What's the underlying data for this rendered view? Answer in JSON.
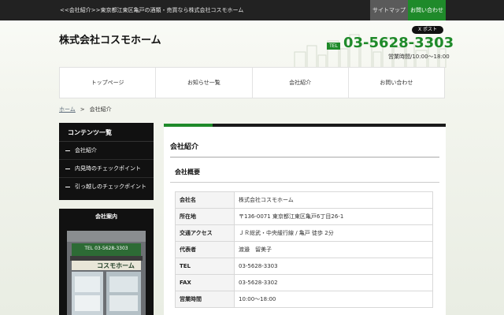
{
  "topbar": {
    "tagline": "<<会社紹介>>東京都江東区亀戸の酒類・売買なら株式会社コスモホーム",
    "sitemap": "サイトマップ",
    "contact": "お問い合わせ"
  },
  "header": {
    "logo": "株式会社コスモホーム",
    "post_button": "X ポスト",
    "tel_badge": "TEL",
    "tel_number": "03-5628-3303",
    "hours": "営業時間/10:00～18:00"
  },
  "nav": {
    "items": [
      "トップページ",
      "お知らせ一覧",
      "会社紹介",
      "お問い合わせ"
    ]
  },
  "breadcrumb": {
    "home": "ホーム",
    "sep": ">",
    "current": "会社紹介"
  },
  "sidebar": {
    "title": "コンテンツ一覧",
    "items": [
      "会社紹介",
      "内見時のチェックポイント",
      "引っ越しのチェックポイント"
    ],
    "company_title": "会社案内",
    "photo_sign_text": "コスモホーム",
    "photo_tel_text": "TEL 03-5628-3303"
  },
  "main": {
    "title": "会社紹介",
    "subtitle": "会社概要",
    "rows": [
      {
        "k": "会社名",
        "v": "株式会社コスモホーム"
      },
      {
        "k": "所在地",
        "v": "〒136-0071 東京都江東区亀戸6丁目26-1"
      },
      {
        "k": "交通アクセス",
        "v": "ＪＲ総武・中央緩行線 / 亀戸 徒歩 2分"
      },
      {
        "k": "代表者",
        "v": "渡邉　留美子"
      },
      {
        "k": "TEL",
        "v": "03-5628-3303"
      },
      {
        "k": "FAX",
        "v": "03-5628-3302"
      },
      {
        "k": "営業時間",
        "v": "10:00～18:00"
      }
    ]
  },
  "colors": {
    "accent": "#1f8a2a",
    "dark": "#111111"
  }
}
